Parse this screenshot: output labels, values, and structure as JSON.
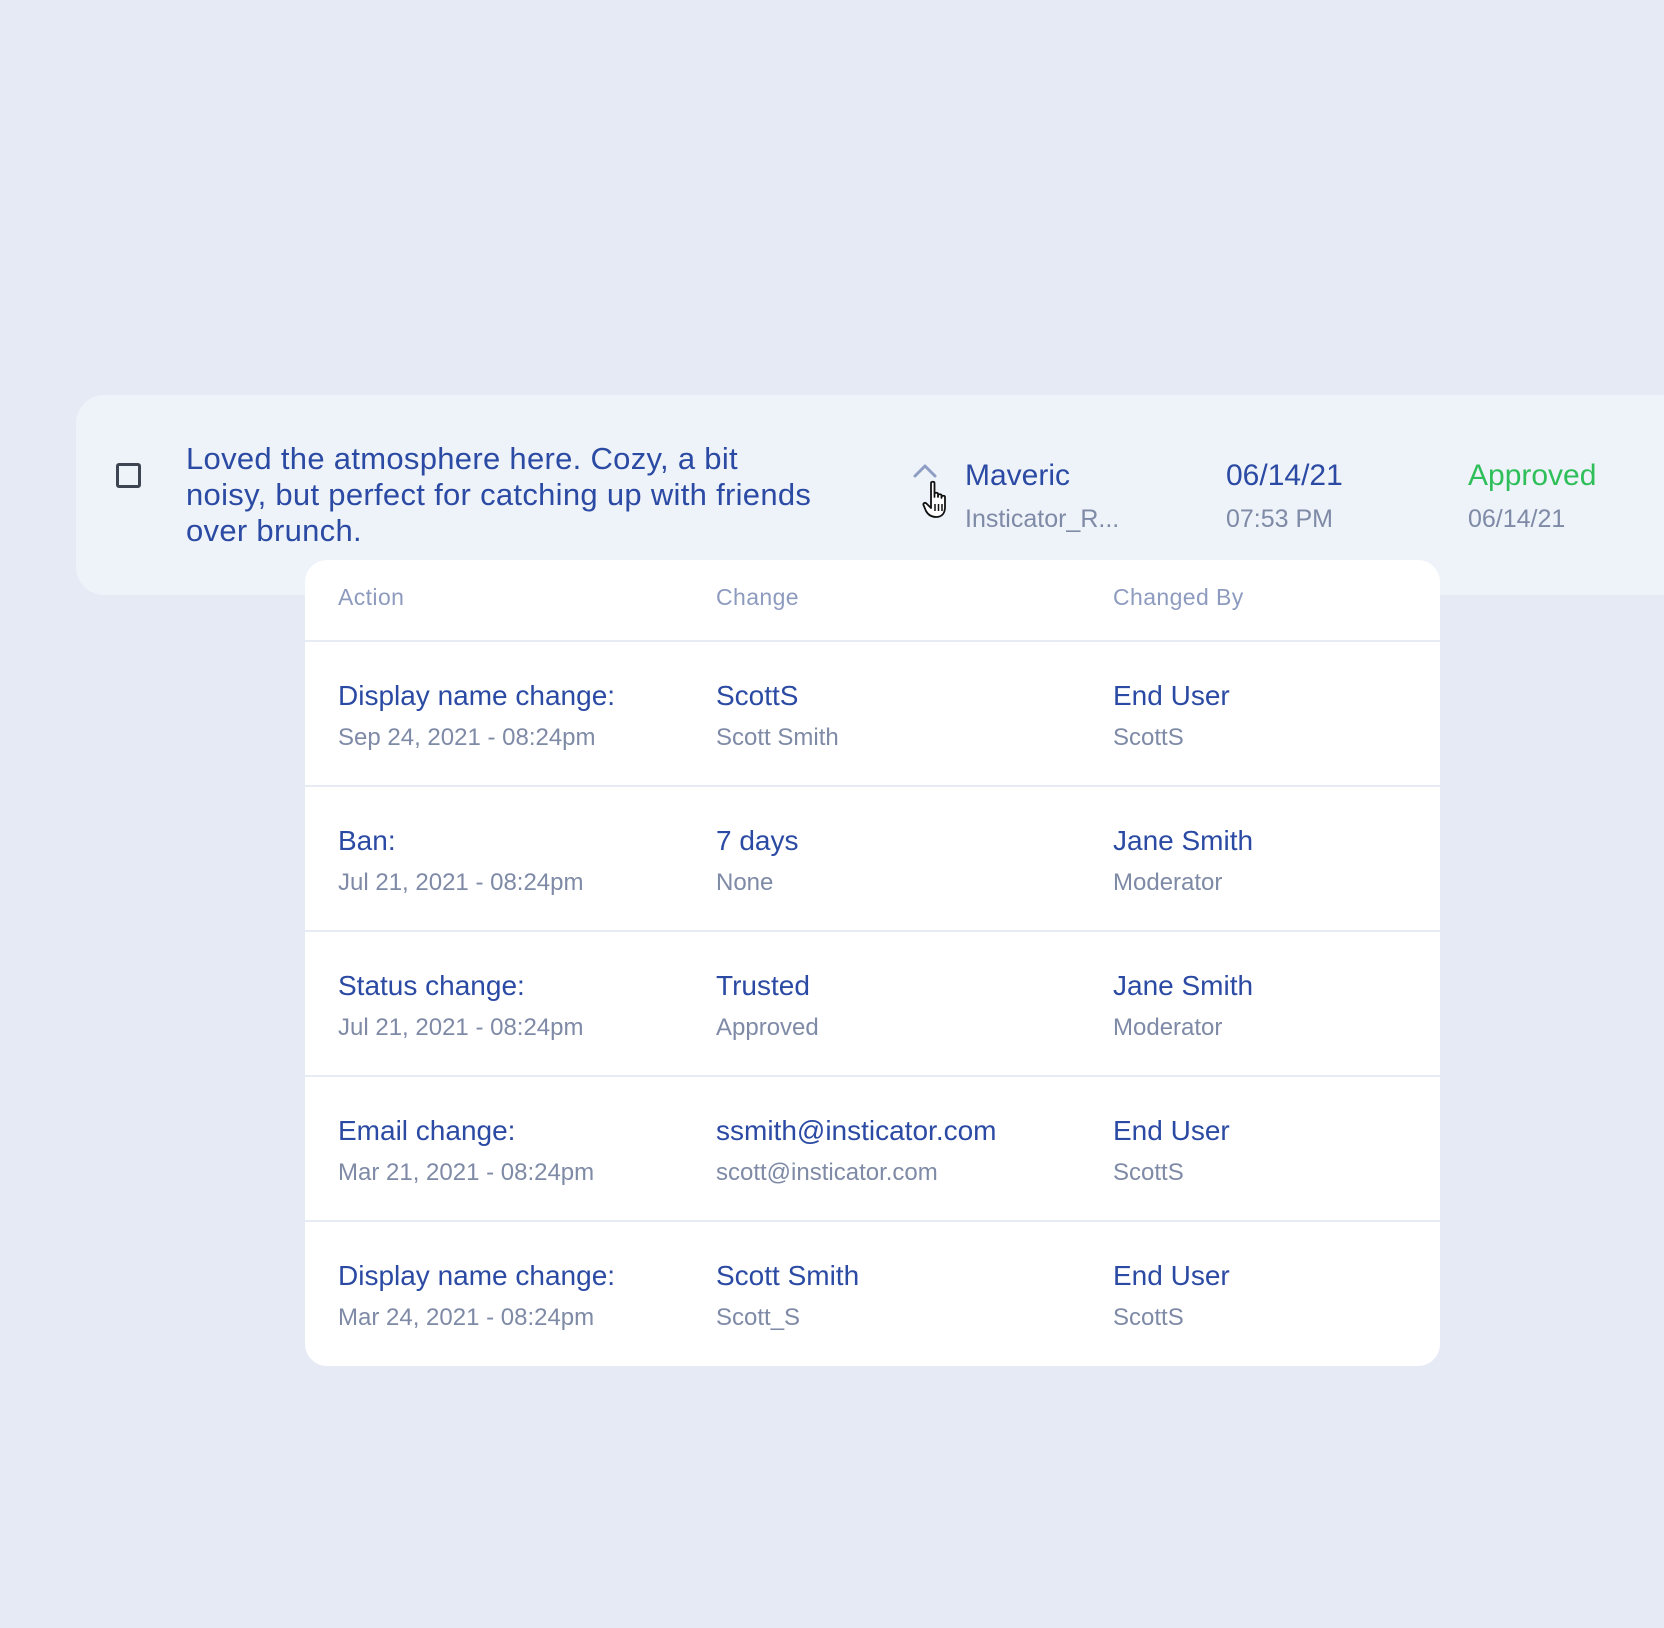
{
  "comment": {
    "text": "Loved the atmosphere here. Cozy, a bit noisy, but perfect for catching up with friends over brunch.",
    "author_name": "Maveric",
    "author_source": "Insticator_R...",
    "date": "06/14/21",
    "time": "07:53 PM",
    "status": "Approved",
    "status_date": "06/14/21",
    "status_color": "#2fbf5a"
  },
  "history": {
    "headers": {
      "action": "Action",
      "change": "Change",
      "changed_by": "Changed By"
    },
    "rows": [
      {
        "action": "Display name change:",
        "date": "Sep 24, 2021 - 08:24pm",
        "new_value": "ScottS",
        "old_value": "Scott Smith",
        "by_name": "End User",
        "by_role": "ScottS"
      },
      {
        "action": "Ban:",
        "date": "Jul 21, 2021 - 08:24pm",
        "new_value": "7 days",
        "old_value": "None",
        "by_name": "Jane Smith",
        "by_role": "Moderator"
      },
      {
        "action": "Status change:",
        "date": "Jul 21, 2021 - 08:24pm",
        "new_value": "Trusted",
        "old_value": "Approved",
        "by_name": "Jane Smith",
        "by_role": "Moderator"
      },
      {
        "action": "Email change:",
        "date": "Mar 21, 2021 - 08:24pm",
        "new_value": "ssmith@insticator.com",
        "old_value": "scott@insticator.com",
        "by_name": "End User",
        "by_role": "ScottS"
      },
      {
        "action": "Display name change:",
        "date": "Mar 24, 2021 - 08:24pm",
        "new_value": "Scott Smith",
        "old_value": "Scott_S",
        "by_name": "End User",
        "by_role": "ScottS"
      }
    ]
  },
  "colors": {
    "background": "#e5eaf5",
    "primary_text": "#2b4aa3",
    "secondary_text": "#7e8aa6",
    "approved": "#2fbf5a"
  },
  "icons": {
    "expand": "chevron-up-icon",
    "cursor": "hand-pointer-cursor-icon"
  }
}
